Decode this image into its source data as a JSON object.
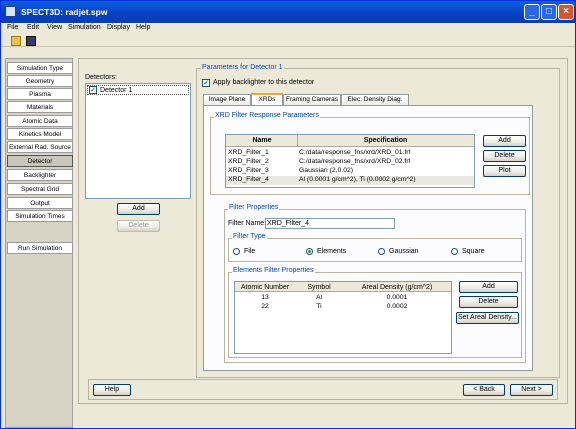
{
  "window": {
    "title": "SPECT3D:  radjet.spw"
  },
  "menu": [
    {
      "label": "File"
    },
    {
      "label": "Edit"
    },
    {
      "label": "View"
    },
    {
      "label": "Simulation"
    },
    {
      "label": "Display"
    },
    {
      "label": "Help"
    }
  ],
  "nav": [
    "Simulation Type",
    "Geometry",
    "Plasma",
    "Materials",
    "Atomic Data",
    "Kinetics Model",
    "External Rad. Source",
    "Detector",
    "Backlighter",
    "Spectral Grid",
    "Output",
    "Simulation Times",
    "Run Simulation"
  ],
  "detectors": {
    "label": "Detectors:",
    "items": [
      "Detector 1"
    ],
    "add": "Add",
    "delete": "Delete"
  },
  "params": {
    "title": "Parameters for Detector 1",
    "backlighter": "Apply backlighter to this detector"
  },
  "tabs": [
    "Image Plane",
    "XRDs",
    "Framing Cameras",
    "Elec. Density Diag."
  ],
  "xrd": {
    "group": "XRD Filter Response Parameters",
    "headers": {
      "name": "Name",
      "spec": "Specification"
    },
    "rows": [
      {
        "name": "XRD_Filter_1",
        "spec": "C:/data/response_fns/xrd/XRD_01.frf"
      },
      {
        "name": "XRD_Filter_2",
        "spec": "C:/data/response_fns/xrd/XRD_02.frf"
      },
      {
        "name": "XRD_Filter_3",
        "spec": "Gaussian (2,0.02)"
      },
      {
        "name": "XRD_Filter_4",
        "spec": "Al (0.0001 g/cm^2), Ti (0.0002 g/cm^2)"
      }
    ],
    "add": "Add",
    "delete": "Delete",
    "plot": "Plot"
  },
  "filterProps": {
    "group": "Filter Properties",
    "nameLabel": "Filter Name:",
    "nameValue": "XRD_Filter_4",
    "typeGroup": "Filter Type",
    "types": [
      "File",
      "Elements",
      "Gaussian",
      "Square"
    ]
  },
  "elements": {
    "group": "Elements Filter Properties",
    "headers": {
      "z": "Atomic Number",
      "sym": "Symbol",
      "dens": "Areal Density (g/cm^2)"
    },
    "rows": [
      {
        "z": "13",
        "sym": "Al",
        "dens": "0.0001"
      },
      {
        "z": "22",
        "sym": "Ti",
        "dens": "0.0002"
      }
    ],
    "add": "Add",
    "delete": "Delete",
    "set": "Set  Areal Density..."
  },
  "bottom": {
    "help": "Help",
    "back": "< Back",
    "next": "Next >"
  }
}
